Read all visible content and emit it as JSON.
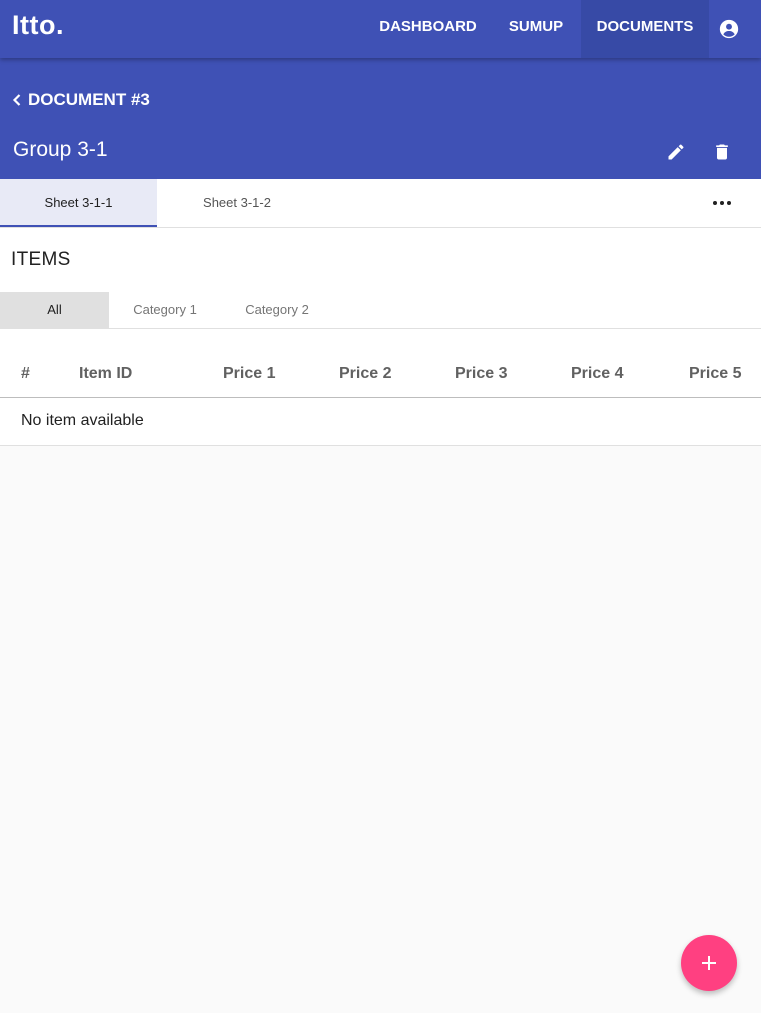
{
  "appbar": {
    "logo": "Itto.",
    "nav": [
      "DASHBOARD",
      "SUMUP",
      "DOCUMENTS"
    ],
    "active_nav": "DOCUMENTS",
    "color": "#3f51b5",
    "account_icon": "account-circle-icon"
  },
  "header": {
    "back_label": "DOCUMENT #3",
    "group_title": "Group 3-1",
    "edit_icon": "pencil-icon",
    "delete_icon": "trash-icon"
  },
  "sheet_tabs": {
    "tabs": [
      "Sheet 3-1-1",
      "Sheet 3-1-2"
    ],
    "active": "Sheet 3-1-1",
    "more_icon": "more-horizontal-icon"
  },
  "items": {
    "title": "ITEMS",
    "category_tabs": [
      "All",
      "Category 1",
      "Category 2"
    ],
    "active_category": "All",
    "columns": [
      "#",
      "Item ID",
      "Price 1",
      "Price 2",
      "Price 3",
      "Price 4",
      "Price 5"
    ],
    "empty_message": "No item available"
  },
  "fab": {
    "icon": "plus-icon",
    "color": "#ff4081"
  }
}
